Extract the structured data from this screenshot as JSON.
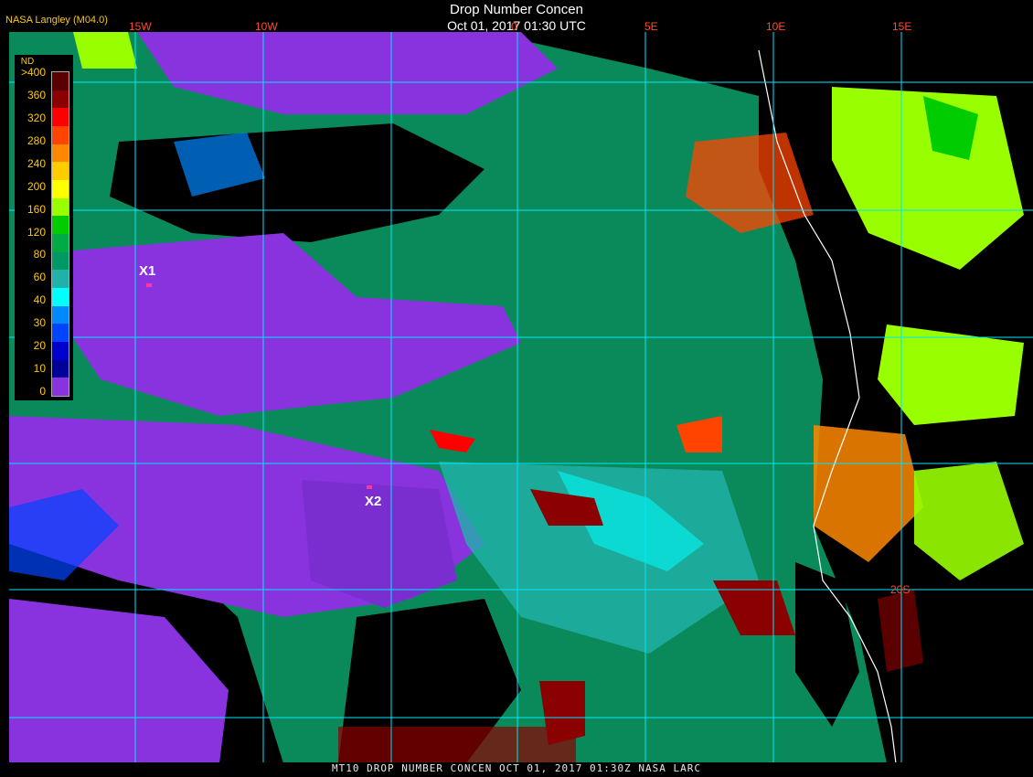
{
  "header": {
    "logo": "NASA Langley (M04.0)",
    "title": "Drop Number Concen",
    "datetime": "Oct 01, 2017 01:30 UTC"
  },
  "grid": {
    "lon_labels": [
      "15W",
      "10W",
      "0",
      "5E",
      "10E",
      "15E"
    ],
    "lat_labels": [
      "20S"
    ]
  },
  "legend": {
    "title": "ND",
    "ticks": [
      ">400",
      "360",
      "320",
      "280",
      "240",
      "200",
      "160",
      "120",
      "80",
      "60",
      "40",
      "30",
      "20",
      "10",
      "0"
    ],
    "colors": [
      "#5a0000",
      "#8b0000",
      "#ff0000",
      "#ff4400",
      "#ff8800",
      "#ffcc00",
      "#ffff00",
      "#99ff00",
      "#00cc00",
      "#00aa44",
      "#009966",
      "#20b2aa",
      "#00ffff",
      "#0088ff",
      "#0044ff",
      "#0000cc",
      "#000099",
      "#8833dd"
    ]
  },
  "markers": [
    {
      "label": "X1"
    },
    {
      "label": "X2"
    }
  ],
  "footer": "MT10   DROP NUMBER CONCEN   OCT 01, 2017 01:30Z   NASA LARC",
  "colors": {
    "ocean_cloud": "#0a8a5a",
    "low_nd": "#8833dd",
    "clear": "#000000",
    "grid": "#00e5ff",
    "label": "#ff4a2a"
  }
}
